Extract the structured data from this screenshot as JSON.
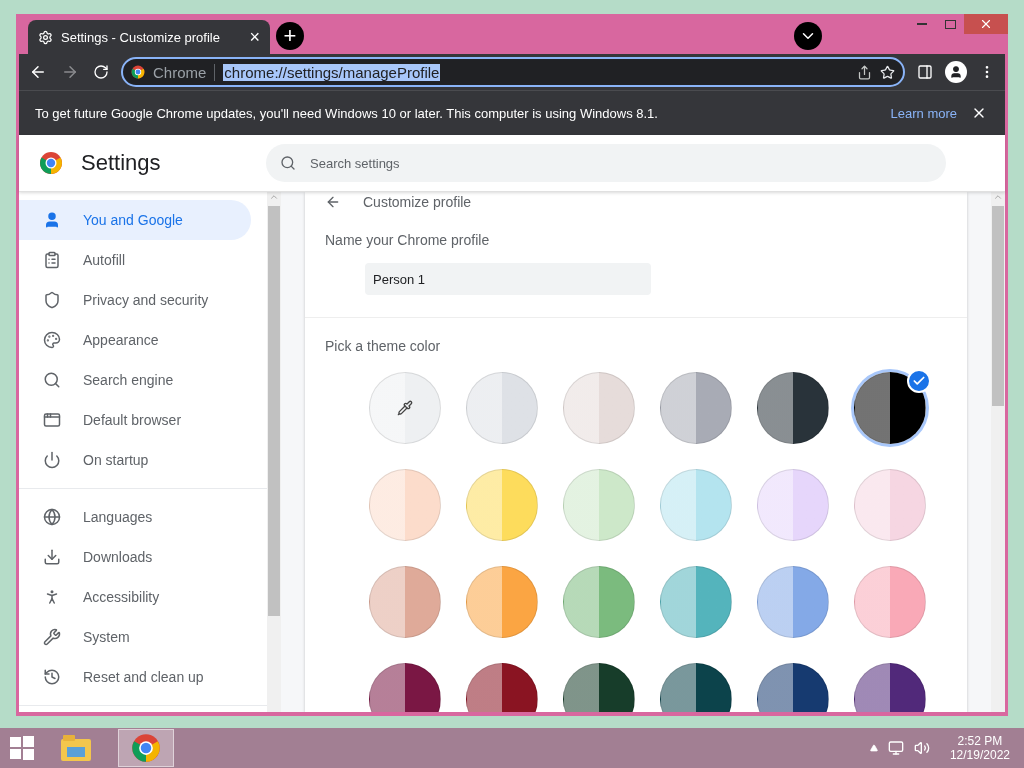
{
  "browser": {
    "tab": {
      "title": "Settings - Customize profile",
      "close": "×"
    },
    "new_tab": "+",
    "omnibox": {
      "chip": "Chrome",
      "url": "chrome://settings/manageProfile",
      "url_selected": true
    }
  },
  "infobar": {
    "message": "To get future Google Chrome updates, you'll need Windows 10 or later. This computer is using Windows 8.1.",
    "link": "Learn more"
  },
  "header": {
    "title": "Settings",
    "search": {
      "placeholder": "Search settings"
    }
  },
  "sidebar": {
    "groups": [
      {
        "items": [
          {
            "label": "You and Google",
            "selected": true
          },
          {
            "label": "Autofill",
            "selected": false
          },
          {
            "label": "Privacy and security",
            "selected": false
          },
          {
            "label": "Appearance",
            "selected": false
          },
          {
            "label": "Search engine",
            "selected": false
          },
          {
            "label": "Default browser",
            "selected": false
          },
          {
            "label": "On startup",
            "selected": false
          }
        ]
      },
      {
        "items": [
          {
            "label": "Languages",
            "selected": false
          },
          {
            "label": "Downloads",
            "selected": false
          },
          {
            "label": "Accessibility",
            "selected": false
          },
          {
            "label": "System",
            "selected": false
          },
          {
            "label": "Reset and clean up",
            "selected": false
          }
        ]
      }
    ]
  },
  "page": {
    "title": "Customize profile",
    "name_label": "Name your Chrome profile",
    "name_value": "Person 1",
    "theme_label": "Pick a theme color",
    "swatches": [
      {
        "kind": "picker",
        "color": "#eef0f2",
        "selected": false
      },
      {
        "kind": "color",
        "color": "#dee1e6",
        "selected": false
      },
      {
        "kind": "color",
        "color": "#e6dcda",
        "selected": false
      },
      {
        "kind": "color",
        "color": "#a8abb5",
        "selected": false
      },
      {
        "kind": "color",
        "color": "#29333a",
        "selected": false
      },
      {
        "kind": "color",
        "color": "#000000",
        "selected": true
      },
      {
        "kind": "color",
        "color": "#fcdccb",
        "selected": false
      },
      {
        "kind": "color",
        "color": "#fddc5c",
        "selected": false
      },
      {
        "kind": "color",
        "color": "#cde8c9",
        "selected": false
      },
      {
        "kind": "color",
        "color": "#b4e4ef",
        "selected": false
      },
      {
        "kind": "color",
        "color": "#e6d6fb",
        "selected": false
      },
      {
        "kind": "color",
        "color": "#f6d6e2",
        "selected": false
      },
      {
        "kind": "color",
        "color": "#dfaa99",
        "selected": false
      },
      {
        "kind": "color",
        "color": "#fba543",
        "selected": false
      },
      {
        "kind": "color",
        "color": "#7bbb7e",
        "selected": false
      },
      {
        "kind": "color",
        "color": "#54b4bc",
        "selected": false
      },
      {
        "kind": "color",
        "color": "#84a9e7",
        "selected": false
      },
      {
        "kind": "color",
        "color": "#f9a9b7",
        "selected": false
      },
      {
        "kind": "color",
        "color": "#7a1744",
        "selected": false
      },
      {
        "kind": "color",
        "color": "#8a1422",
        "selected": false
      },
      {
        "kind": "color",
        "color": "#173d2a",
        "selected": false
      },
      {
        "kind": "color",
        "color": "#0c434b",
        "selected": false
      },
      {
        "kind": "color",
        "color": "#163a70",
        "selected": false
      },
      {
        "kind": "color",
        "color": "#51297a",
        "selected": false
      }
    ]
  },
  "taskbar": {
    "time": "2:52 PM",
    "date": "12/19/2022"
  }
}
